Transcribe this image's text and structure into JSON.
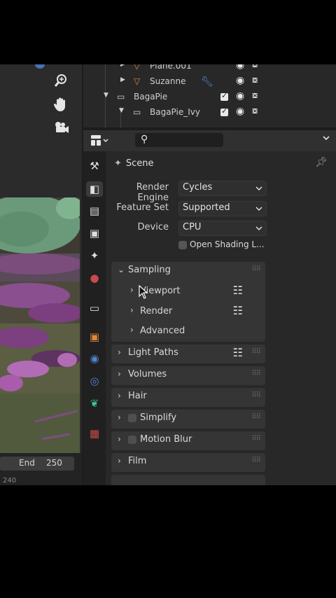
{
  "outliner": {
    "rows": [
      {
        "name": "Plane.001"
      },
      {
        "name": "Suzanne"
      },
      {
        "name": "BagaPie"
      },
      {
        "name": "BagaPie_Ivy"
      }
    ]
  },
  "timeline": {
    "end_label": "End",
    "end_value": "250",
    "current_frame": "240"
  },
  "properties": {
    "context": "Scene",
    "render_engine": {
      "label": "Render Engine",
      "value": "Cycles"
    },
    "feature_set": {
      "label": "Feature Set",
      "value": "Supported"
    },
    "device": {
      "label": "Device",
      "value": "CPU"
    },
    "open_shading": "Open Shading L...",
    "panels": {
      "sampling": "Sampling",
      "viewport": "Viewport",
      "render": "Render",
      "advanced": "Advanced",
      "light_paths": "Light Paths",
      "volumes": "Volumes",
      "hair": "Hair",
      "simplify": "Simplify",
      "motion_blur": "Motion Blur",
      "film": "Film"
    }
  },
  "colors": {
    "accent_blue": "#4772b3",
    "cone_orange": "#e08a3c",
    "panel_bg": "#353535"
  }
}
